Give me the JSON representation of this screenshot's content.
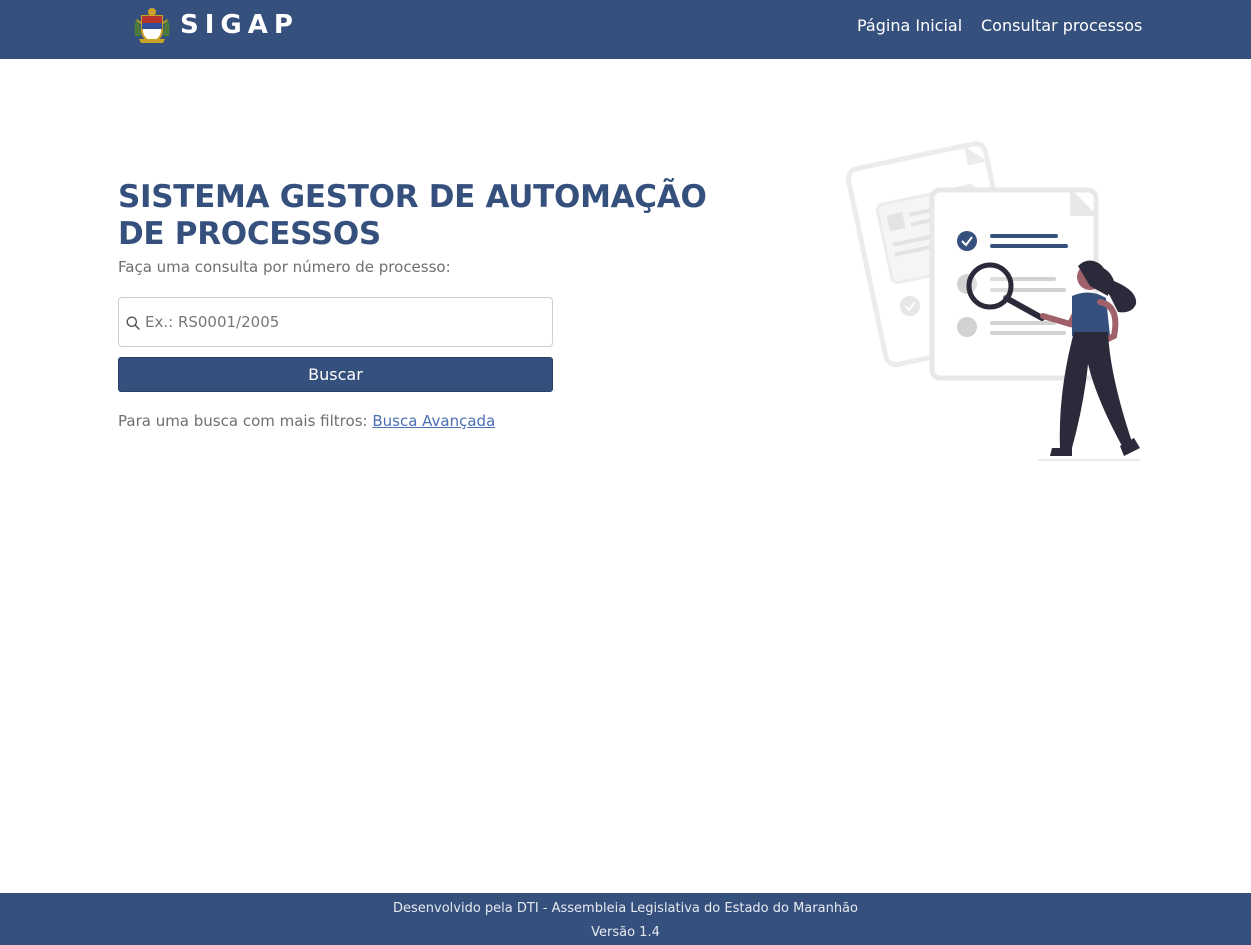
{
  "header": {
    "brand": "SIGAP",
    "nav": {
      "home": "Página Inicial",
      "consult": "Consultar processos"
    }
  },
  "main": {
    "title": "SISTEMA GESTOR DE AUTOMAÇÃO DE PROCESSOS",
    "subtitle": "Faça uma consulta por número de processo:",
    "search": {
      "placeholder": "Ex.: RS0001/2005",
      "value": ""
    },
    "search_button": "Buscar",
    "advanced_prefix": "Para uma busca com mais filtros:",
    "advanced_link": "Busca Avançada"
  },
  "footer": {
    "credit": "Desenvolvido pela DTI - Assembleia Legislativa do Estado do Maranhão",
    "version": "Versão 1.4"
  },
  "colors": {
    "primary": "#36507e",
    "link": "#4a6fb5",
    "muted_text": "#6f6f6f"
  },
  "icons": [
    "state-coat-of-arms-icon",
    "search-icon",
    "woman-with-magnifier-illustration"
  ]
}
